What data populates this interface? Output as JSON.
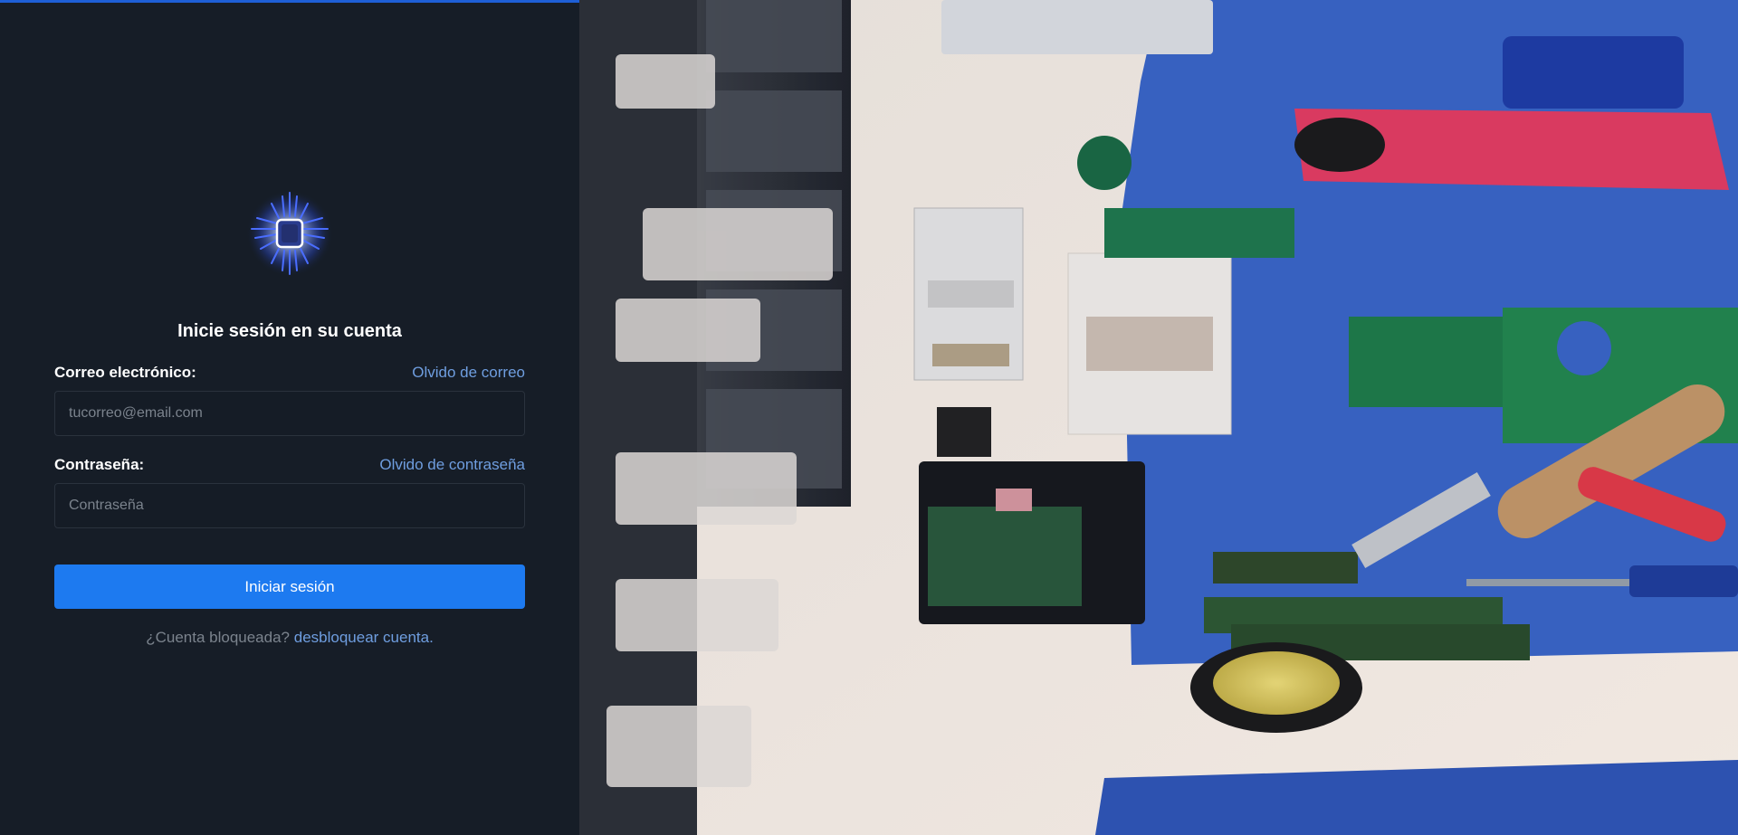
{
  "login": {
    "title": "Inicie sesión en su cuenta",
    "email_label": "Correo electrónico:",
    "email_forgot_link": "Olvido de correo",
    "email_placeholder": "tucorreo@email.com",
    "password_label": "Contraseña:",
    "password_forgot_link": "Olvido de contraseña",
    "password_placeholder": "Contraseña",
    "submit_label": "Iniciar sesión",
    "locked_text": "¿Cuenta bloqueada?",
    "unlock_link": "desbloquear cuenta."
  },
  "logo": {
    "icon": "microchip-icon"
  },
  "colors": {
    "panel_bg": "#161d27",
    "accent": "#1d7af0",
    "link": "#6f9ee0",
    "top_border": "#1e5fd6"
  },
  "hero": {
    "icon": "electronics-workbench-photo"
  }
}
